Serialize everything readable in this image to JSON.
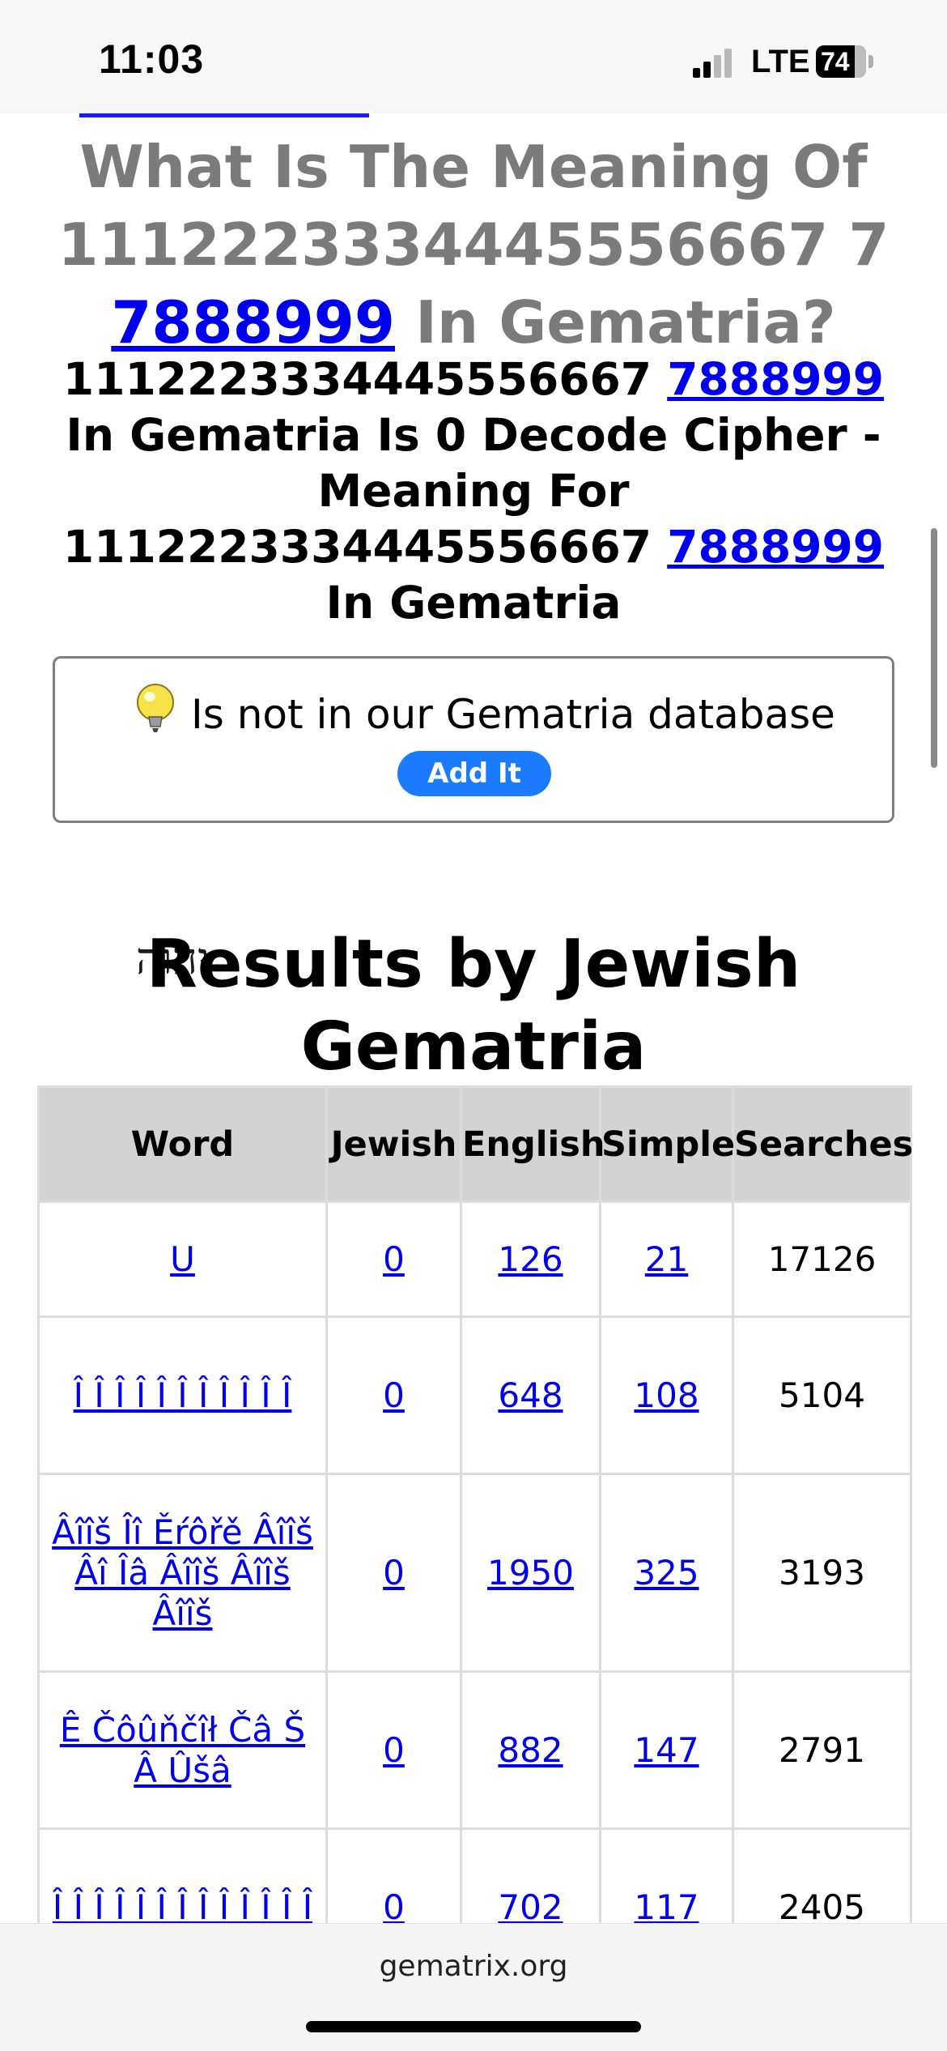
{
  "status_bar": {
    "time": "11:03",
    "network": "LTE",
    "battery": "74"
  },
  "heading": {
    "prefix": "What Is The Meaning Of 1112223334445556667 7",
    "link": "7888999",
    "suffix": " In Gematria?"
  },
  "subheading": {
    "line1_text": "1112223334445556667 ",
    "line1_link": "7888999",
    "line2": "In Gematria Is 0 Decode Cipher - Meaning For",
    "line3_text": "1112223334445556667 ",
    "line3_link": "7888999",
    "line4": "In Gematria"
  },
  "not_found": {
    "message": "Is not in our Gematria database",
    "button": "Add It",
    "icon": "lightbulb-icon"
  },
  "results": {
    "title": "Results by Jewish Gematria",
    "icon_text": "יהוה",
    "columns": [
      "Word",
      "Jewish",
      "English",
      "Simple",
      "Searches"
    ],
    "rows": [
      {
        "word": "U",
        "jewish": "0",
        "english": "126",
        "simple": "21",
        "searches": "17126"
      },
      {
        "word": "Î Î Î Î Î Î Î Î Î Î Î",
        "jewish": "0",
        "english": "648",
        "simple": "108",
        "searches": "5104"
      },
      {
        "word": "Âîîš Îî Ěŕôřě Âîîš Âî Îâ Âîîš Âîîš Âîîš",
        "jewish": "0",
        "english": "1950",
        "simple": "325",
        "searches": "3193"
      },
      {
        "word": "Ê Čôûňčîł Čâ Š Â Ûšâ",
        "jewish": "0",
        "english": "882",
        "simple": "147",
        "searches": "2791"
      },
      {
        "word": "Î Î Î Î Î Î Î Î Î Î Î Î Î",
        "jewish": "0",
        "english": "702",
        "simple": "117",
        "searches": "2405"
      }
    ]
  },
  "browser": {
    "url": "gematrix.org"
  }
}
